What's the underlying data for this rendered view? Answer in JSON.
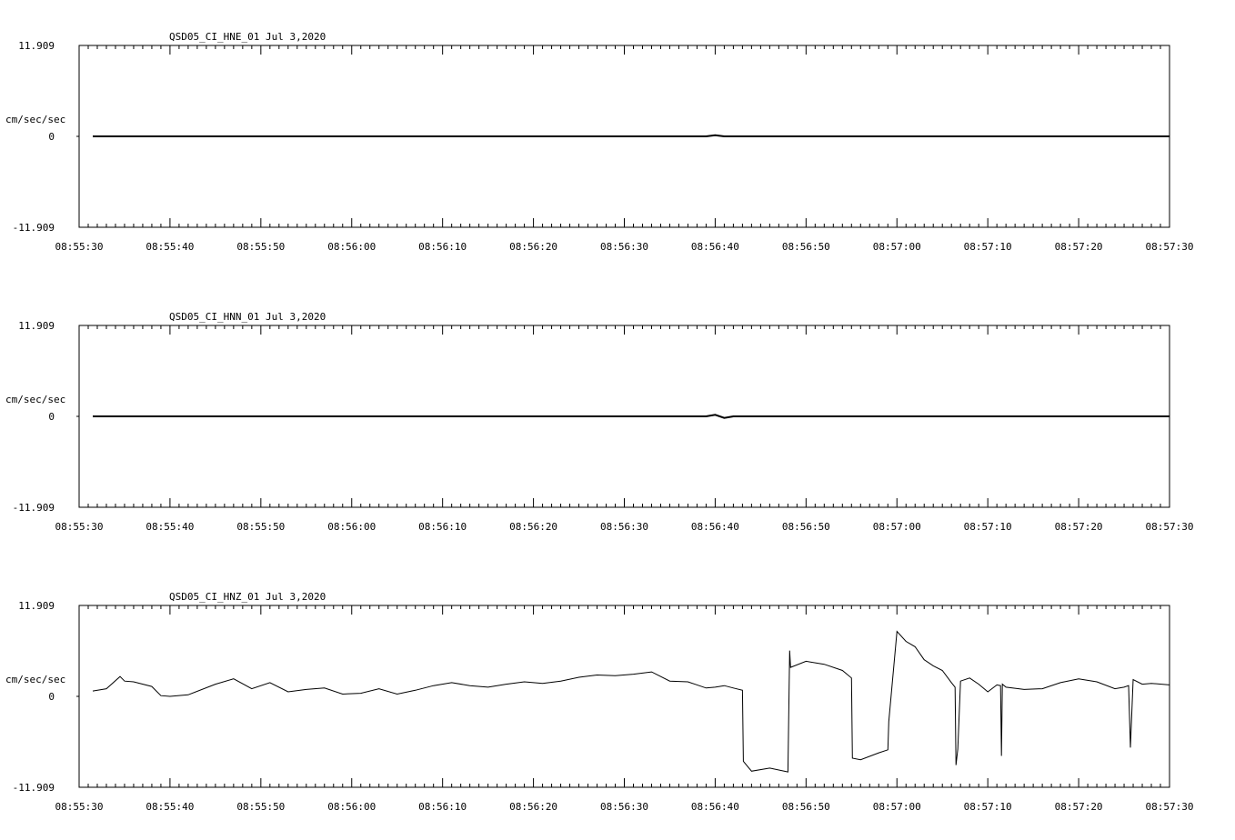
{
  "chart_data": [
    {
      "type": "line",
      "title": "QSD05_CI_HNE_01  Jul 3,2020",
      "ylabel": "cm/sec/sec",
      "ylim": [
        -11.909,
        11.909
      ],
      "yticks": [
        "11.909",
        "0",
        "-11.909"
      ],
      "xticks": [
        "08:55:30",
        "08:55:40",
        "08:55:50",
        "08:56:00",
        "08:56:10",
        "08:56:20",
        "08:56:30",
        "08:56:40",
        "08:56:50",
        "08:57:00",
        "08:57:10",
        "08:57:20",
        "08:57:30"
      ],
      "x_start_label": "08:55:30",
      "x_end_label": "08:57:30",
      "series": [
        {
          "x": [
            1.5,
            20,
            40,
            60,
            69,
            70,
            71,
            80,
            100,
            120
          ],
          "y": [
            0,
            0,
            0,
            0,
            0,
            0.15,
            0,
            0,
            0,
            0
          ]
        }
      ]
    },
    {
      "type": "line",
      "title": "QSD05_CI_HNN_01  Jul 3,2020",
      "ylabel": "cm/sec/sec",
      "ylim": [
        -11.909,
        11.909
      ],
      "yticks": [
        "11.909",
        "0",
        "-11.909"
      ],
      "xticks": [
        "08:55:30",
        "08:55:40",
        "08:55:50",
        "08:56:00",
        "08:56:10",
        "08:56:20",
        "08:56:30",
        "08:56:40",
        "08:56:50",
        "08:57:00",
        "08:57:10",
        "08:57:20",
        "08:57:30"
      ],
      "x_start_label": "08:55:30",
      "x_end_label": "08:57:30",
      "series": [
        {
          "x": [
            1.5,
            20,
            40,
            60,
            69,
            70,
            71,
            72,
            80,
            100,
            120
          ],
          "y": [
            0,
            0,
            0,
            0,
            0,
            0.2,
            -0.2,
            0,
            0,
            0,
            0
          ]
        }
      ]
    },
    {
      "type": "line",
      "title": "QSD05_CI_HNZ_01  Jul 3,2020",
      "ylabel": "cm/sec/sec",
      "ylim": [
        -11.909,
        11.909
      ],
      "yticks": [
        "11.909",
        "0",
        "-11.909"
      ],
      "xticks": [
        "08:55:30",
        "08:55:40",
        "08:55:50",
        "08:56:00",
        "08:56:10",
        "08:56:20",
        "08:56:30",
        "08:56:40",
        "08:56:50",
        "08:57:00",
        "08:57:10",
        "08:57:20",
        "08:57:30"
      ],
      "x_start_label": "08:55:30",
      "x_end_label": "08:57:30",
      "series": [
        {
          "x": [
            1.5,
            3,
            4.5,
            5,
            6,
            8,
            9,
            10,
            12,
            15,
            17,
            19,
            21,
            23,
            25,
            27,
            29,
            31,
            33,
            35,
            37,
            39,
            41,
            43,
            45,
            47,
            49,
            51,
            53,
            55,
            57,
            59,
            61,
            63,
            65,
            67,
            69,
            70,
            71,
            72,
            73,
            73.1,
            74,
            76,
            78,
            78.2,
            78.3,
            80,
            82,
            84,
            85,
            85.1,
            86,
            88,
            89,
            89.1,
            90,
            91,
            92,
            93,
            94,
            95,
            96,
            96.4,
            96.5,
            96.7,
            97,
            98,
            99,
            100,
            101,
            101.4,
            101.5,
            101.6,
            102,
            104,
            106,
            108,
            110,
            112,
            114,
            115,
            115.5,
            115.7,
            116,
            117,
            118,
            120
          ],
          "y": [
            0.7,
            1.0,
            2.6,
            2.0,
            1.9,
            1.3,
            0.1,
            0.0,
            0.2,
            1.6,
            2.3,
            1.0,
            1.8,
            0.6,
            0.9,
            1.1,
            0.3,
            0.4,
            1.0,
            0.3,
            0.8,
            1.4,
            1.8,
            1.4,
            1.2,
            1.6,
            1.9,
            1.7,
            2.0,
            2.5,
            2.8,
            2.7,
            2.9,
            3.2,
            2.0,
            1.9,
            1.1,
            1.2,
            1.4,
            1.1,
            0.8,
            -8.5,
            -9.8,
            -9.4,
            -9.9,
            6.0,
            3.8,
            4.6,
            4.2,
            3.4,
            2.4,
            -8.1,
            -8.3,
            -7.4,
            -7.0,
            -3.3,
            8.5,
            7.2,
            6.5,
            4.8,
            4.0,
            3.4,
            1.8,
            1.2,
            -9.0,
            -6.9,
            2.0,
            2.4,
            1.6,
            0.6,
            1.5,
            1.4,
            -7.8,
            1.6,
            1.2,
            0.9,
            1.0,
            1.8,
            2.3,
            1.9,
            1.0,
            1.2,
            1.4,
            -6.7,
            2.2,
            1.6,
            1.7,
            1.5
          ]
        }
      ]
    }
  ]
}
